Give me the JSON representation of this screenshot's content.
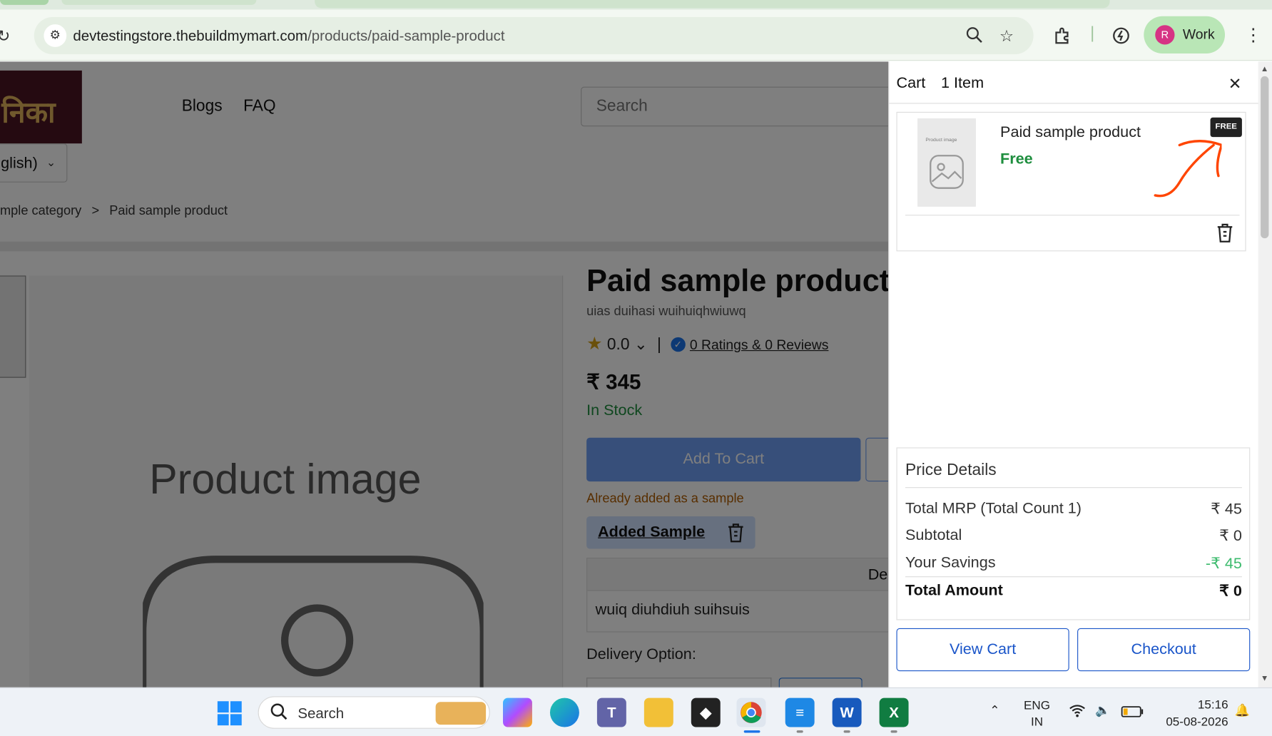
{
  "browser": {
    "url_host": "devtestingstore.thebuildmymart.com",
    "url_path": "/products/paid-sample-product",
    "profile_initial": "R",
    "profile_name": "Work"
  },
  "header": {
    "logo_text": "निका",
    "nav": [
      "Blogs",
      "FAQ"
    ],
    "search_placeholder": "Search",
    "language": "glish)"
  },
  "breadcrumb": {
    "parent": "mple category",
    "separator": ">",
    "current": "Paid sample product"
  },
  "product": {
    "image_caption": "Product image",
    "title": "Paid sample product",
    "subtitle": "uias duihasi wuihuiqhwiuwq",
    "rating": "0.0",
    "reviews_link": "0 Ratings & 0 Reviews",
    "price": "₹ 345",
    "stock": "In Stock",
    "add_to_cart": "Add To Cart",
    "already_note": "Already added as a sample",
    "added_sample": "Added Sample",
    "details_header": "De",
    "details_row": "wuiq diuhdiuh suihsuis",
    "delivery_label": "Delivery Option:"
  },
  "cart": {
    "title": "Cart",
    "count": "1 Item",
    "item": {
      "image_caption": "Product image",
      "name": "Paid sample product",
      "price": "Free",
      "badge": "FREE"
    },
    "price_details": {
      "heading": "Price Details",
      "rows": [
        {
          "label": "Total MRP (Total Count 1)",
          "value": "₹ 45"
        },
        {
          "label": "Subtotal",
          "value": "₹ 0"
        },
        {
          "label": "Your Savings",
          "value": "-₹ 45"
        }
      ],
      "total_label": "Total Amount",
      "total_value": "₹ 0"
    },
    "view_cart": "View Cart",
    "checkout": "Checkout"
  },
  "taskbar": {
    "search_label": "Search",
    "lang_line1": "ENG",
    "lang_line2": "IN",
    "time": "15:16",
    "date": "05-08-2026"
  },
  "colors": {
    "brand_blue": "#1a55c9",
    "success_green": "#1e8e3e",
    "savings_green": "#3dbb6e",
    "annotation_orange": "#ff4500"
  }
}
